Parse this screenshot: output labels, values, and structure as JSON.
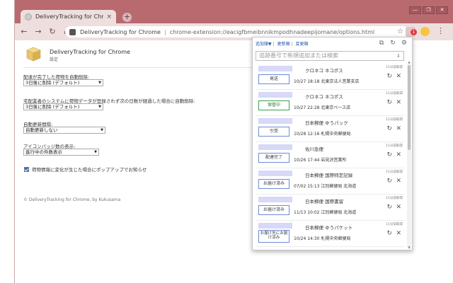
{
  "browser": {
    "tab_title": "DeliveryTracking for Chrome",
    "tab_close": "×",
    "new_tab": "+",
    "window_controls": [
      "—",
      "❐",
      "✕"
    ],
    "omnibox": {
      "site_name": "DeliveryTracking for Chrome",
      "url": "chrome-extension://eacigfbmeibnnikmpodhnadeepijomane/options.html"
    },
    "extension_badge": "1"
  },
  "options": {
    "title": "DeliveryTracking for Chrome",
    "subtitle": "設定",
    "settings": [
      {
        "label": "配達が完了した荷物を自動削除:",
        "value": "3日後に削除 (デフォルト)"
      },
      {
        "label": "宅配業者のシステムに荷物データが登録されず次の日数が経過した場合に自動削除:",
        "value": "3日後に削除 (デフォルト)"
      },
      {
        "label": "自動更新間隔:",
        "value": "自動更新しない"
      },
      {
        "label": "アイコンバッジ数の表示:",
        "value": "進行中の件数表示"
      }
    ],
    "checkbox_label": "荷物情報に変化が生じた場合にポップアップでお知らせ",
    "footer": "© DeliveryTracking for Chrome, by Kukusama"
  },
  "popup": {
    "links": [
      "追加順▼",
      "更新順",
      "変更順"
    ],
    "search_placeholder": "追跡番号で新規追加または検索",
    "items": [
      {
        "status": "発送",
        "carrier": "クロネコ ネコポス",
        "detail": "10/27 18:18 北東京法人営業支店",
        "age": "11分前取得",
        "color": "blue"
      },
      {
        "status": "保管中",
        "carrier": "クロネコ ネコポス",
        "detail": "10/27 22:28 北東京ベース店",
        "age": "11分前取得",
        "color": "green"
      },
      {
        "status": "引受",
        "carrier": "日本郵便 ゆうパック",
        "detail": "10/28 12:16 札幌中央郵便局",
        "age": "11分前取得",
        "color": "blue"
      },
      {
        "status": "配達完了",
        "carrier": "佐川急便",
        "detail": "10/26 17:44 岩見沢営業所",
        "age": "11分前取得",
        "color": "blue"
      },
      {
        "status": "お届け済み",
        "carrier": "日本郵便 国際特定記録",
        "detail": "07/02 15:13 江別郵便局 北海道",
        "age": "11分前取得",
        "color": "blue"
      },
      {
        "status": "お届け済み",
        "carrier": "日本郵便 国際書留",
        "detail": "11/13 10:02 江別郵便局 北海道",
        "age": "11分前取得",
        "color": "blue"
      },
      {
        "status": "お届け先にお届け済み",
        "carrier": "日本郵便 ゆうパケット",
        "detail": "10/24 14:30 札幌中央郵便局",
        "age": "11分前取得",
        "color": "blue"
      }
    ]
  }
}
